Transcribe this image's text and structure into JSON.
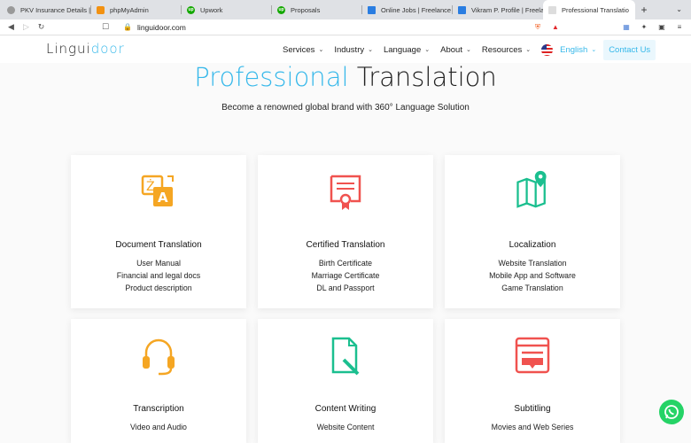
{
  "browser": {
    "tabs": [
      {
        "title": "PKV Insurance Details | Ad",
        "favicon_color": "#999999",
        "active": false
      },
      {
        "title": "phpMyAdmin",
        "favicon_color": "#f29111",
        "active": false
      },
      {
        "title": "Upwork",
        "favicon_color": "#14a800",
        "active": false
      },
      {
        "title": "Proposals",
        "favicon_color": "#14a800",
        "active": false
      },
      {
        "title": "Online Jobs | Freelance Em",
        "favicon_color": "#2a7de1",
        "active": false
      },
      {
        "title": "Vikram P. Profile | Freelan",
        "favicon_color": "#2a7de1",
        "active": false
      },
      {
        "title": "Professional Translatio",
        "favicon_color": "#cccccc",
        "active": true
      }
    ],
    "url": "linguidoor.com"
  },
  "site": {
    "logo_prefix": "Lingui",
    "logo_suffix": "door",
    "accent_color": "#36b8ea",
    "menu": [
      {
        "label": "Services"
      },
      {
        "label": "Industry"
      },
      {
        "label": "Language"
      },
      {
        "label": "About"
      },
      {
        "label": "Resources"
      }
    ],
    "language": "English",
    "contact_label": "Contact Us"
  },
  "hero": {
    "title_accent": "Professional",
    "title_rest": "Translation",
    "subtitle": "Become a renowned global brand with 360° Language Solution"
  },
  "services": [
    {
      "title": "Document Translation",
      "icon": "translate-icon",
      "color": "#f5a623",
      "lines": [
        "User Manual",
        "Financial and legal docs",
        "Product description"
      ]
    },
    {
      "title": "Certified Translation",
      "icon": "certificate-icon",
      "color": "#f0524f",
      "lines": [
        "Birth Certificate",
        "Marriage Certificate",
        "DL and Passport"
      ]
    },
    {
      "title": "Localization",
      "icon": "map-pin-icon",
      "color": "#1bbf8f",
      "lines": [
        "Website Translation",
        "Mobile App and Software",
        "Game Translation"
      ]
    },
    {
      "title": "Transcription",
      "icon": "headset-icon",
      "color": "#f5a623",
      "lines": [
        "Video and Audio"
      ]
    },
    {
      "title": "Content Writing",
      "icon": "document-pen-icon",
      "color": "#1bbf8f",
      "lines": [
        "Website Content"
      ]
    },
    {
      "title": "Subtitling",
      "icon": "subtitles-icon",
      "color": "#f0524f",
      "lines": [
        "Movies and Web Series"
      ]
    }
  ]
}
